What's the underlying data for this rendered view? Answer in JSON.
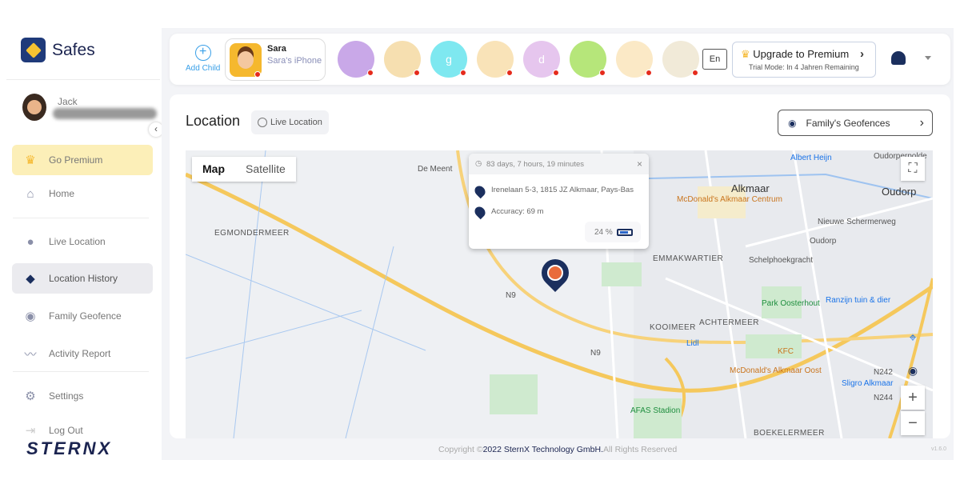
{
  "app": {
    "name": "Safes",
    "brand": "STERNX",
    "accent": "#1b2f5e"
  },
  "sidebar": {
    "user_name": "Jack",
    "items": [
      {
        "label": "Go Premium",
        "icon": "crown-icon"
      },
      {
        "label": "Home",
        "icon": "home-icon"
      },
      {
        "label": "Live Location",
        "icon": "location-pin-icon"
      },
      {
        "label": "Location History",
        "icon": "location-history-icon",
        "active": true
      },
      {
        "label": "Family Geofence",
        "icon": "geofence-icon"
      },
      {
        "label": "Activity Report",
        "icon": "activity-chart-icon"
      },
      {
        "label": "Settings",
        "icon": "gear-icon"
      },
      {
        "label": "Log Out",
        "icon": "logout-icon"
      }
    ]
  },
  "topbar": {
    "add_child": "Add Child",
    "selected_child": {
      "name": "Sara",
      "device": "Sara's iPhone"
    },
    "children": [
      {
        "letter": "",
        "color": "#c9a8e8"
      },
      {
        "letter": "",
        "color": "#f6dfb0"
      },
      {
        "letter": "g",
        "color": "#7ee8f0"
      },
      {
        "letter": "",
        "color": "#f9e3b8"
      },
      {
        "letter": "d",
        "color": "#e6c6ee"
      },
      {
        "letter": "",
        "color": "#b6e67a"
      },
      {
        "letter": "",
        "color": "#fbe9c6"
      },
      {
        "letter": "",
        "color": "#f1ead8"
      }
    ],
    "language": "En",
    "upgrade": {
      "title": "Upgrade to Premium",
      "subtitle": "Trial Mode: In 4 Jahren  Remaining"
    }
  },
  "location": {
    "title": "Location",
    "live_location": "Live Location",
    "geofences_button": "Family's Geofences",
    "map_tabs": [
      "Map",
      "Satellite"
    ],
    "popup": {
      "duration": "83 days, 7 hours, 19 minutes",
      "address": "Irenelaan 5-3, 1815 JZ Alkmaar, Pays-Bas",
      "accuracy": "Accuracy: 69 m",
      "battery": "24 %"
    },
    "map_labels": {
      "de_meent": "De Meent",
      "alkmaar": "Alkmaar",
      "albert_heijn": "Albert Heijn",
      "oudorp": "Oudorp",
      "egmondermeer": "EGMONDERMEER",
      "mcd_centrum": "McDonald's Alkmaar Centrum",
      "nieuwe": "Nieuwe Schermerweg",
      "oudorp2": "Oudorp",
      "schelp": "Schelphoekgracht",
      "emma": "EMMAKWARTIER",
      "park": "Park Oosterhout",
      "ranzijn": "Ranzijn tuin & dier",
      "kooimeer": "KOOIMEER",
      "achtermeer": "ACHTERMEER",
      "lidl": "Lidl",
      "kfc": "KFC",
      "mcd_oost": "McDonald's Alkmaar Oost",
      "sligro": "Sligro Alkmaar",
      "n242": "N242",
      "n244": "N244",
      "n9": "N9",
      "n9b": "N9",
      "afas": "AFAS Stadion",
      "boekel": "BOEKELERMEER",
      "oudorperpolder": "Oudorperpolde"
    }
  },
  "footer": {
    "prefix": "Copyright ©",
    "company": "2022 SternX Technology GmbH.",
    "suffix": "All Rights Reserved",
    "version": "v1.6.0"
  }
}
